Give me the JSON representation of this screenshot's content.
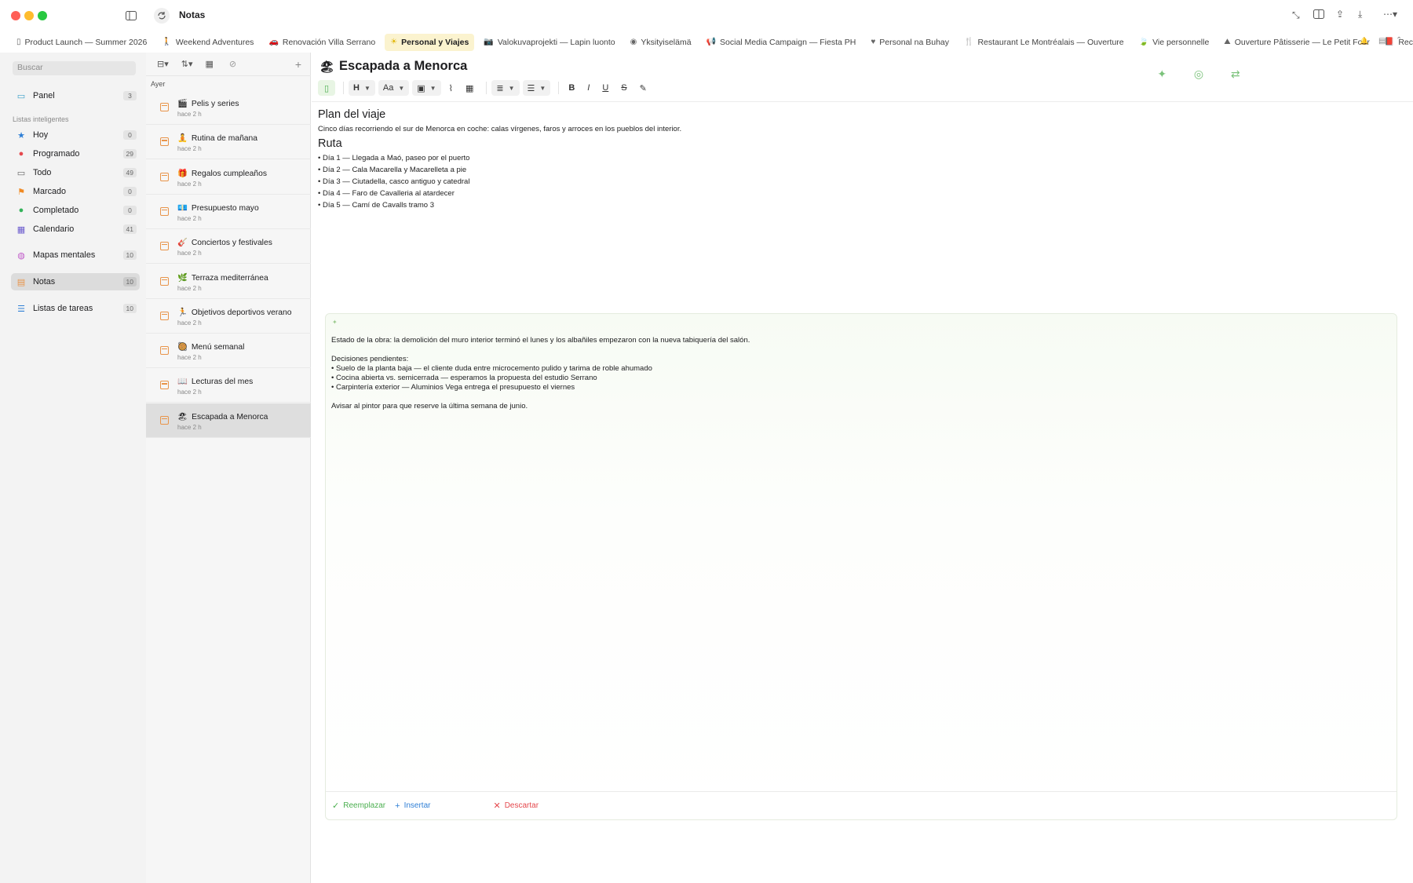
{
  "window": {
    "title": "Notas"
  },
  "tabs": [
    {
      "label": "Product Launch — Summer 2026",
      "icon": "document-icon",
      "glyph": "▯",
      "active": false
    },
    {
      "label": "Weekend Adventures",
      "icon": "hiking-icon",
      "glyph": "🚶",
      "active": false
    },
    {
      "label": "Renovación Villa Serrano",
      "icon": "car-icon",
      "glyph": "🚗",
      "active": false
    },
    {
      "label": "Personal y Viajes",
      "icon": "sun-icon",
      "glyph": "☀",
      "active": true
    },
    {
      "label": "Valokuvaprojekti — Lapin luonto",
      "icon": "camera-icon",
      "glyph": "📷",
      "active": false
    },
    {
      "label": "Yksityiselämä",
      "icon": "circle-icon",
      "glyph": "◉",
      "active": false
    },
    {
      "label": "Social Media Campaign — Fiesta PH",
      "icon": "megaphone-icon",
      "glyph": "📢",
      "active": false
    },
    {
      "label": "Personal na Buhay",
      "icon": "heart-icon",
      "glyph": "♥",
      "active": false
    },
    {
      "label": "Restaurant Le Montréalais — Ouverture",
      "icon": "fork-knife-icon",
      "glyph": "🍴",
      "active": false
    },
    {
      "label": "Vie personnelle",
      "icon": "leaf-icon",
      "glyph": "🍃",
      "active": false
    },
    {
      "label": "Ouverture Pâtisserie — Le Petit Four",
      "icon": "cake-icon",
      "glyph": "⛰",
      "active": false
    },
    {
      "label": "Recettes & Inspirations",
      "icon": "book-icon",
      "glyph": "📕",
      "active": false
    }
  ],
  "sidebar": {
    "search_placeholder": "Buscar",
    "panel": {
      "label": "Panel",
      "count": "3"
    },
    "smart_heading": "Listas inteligentes",
    "smart": [
      {
        "label": "Hoy",
        "count": "0",
        "icon": "star-icon",
        "glyph": "★",
        "color": "#2f7fd6"
      },
      {
        "label": "Programado",
        "count": "29",
        "icon": "clock-icon",
        "glyph": "●",
        "color": "#e5484d"
      },
      {
        "label": "Todo",
        "count": "49",
        "icon": "tray-icon",
        "glyph": "▭",
        "color": "#666666"
      },
      {
        "label": "Marcado",
        "count": "0",
        "icon": "flag-icon",
        "glyph": "⚑",
        "color": "#f08a24"
      },
      {
        "label": "Completado",
        "count": "0",
        "icon": "check-circle-icon",
        "glyph": "●",
        "color": "#34b35a"
      },
      {
        "label": "Calendario",
        "count": "41",
        "icon": "calendar-icon",
        "glyph": "▦",
        "color": "#6a5acd"
      }
    ],
    "mindmaps": {
      "label": "Mapas mentales",
      "count": "10",
      "icon": "brain-icon",
      "glyph": "◍",
      "color": "#c05ac9"
    },
    "notes": {
      "label": "Notas",
      "count": "10",
      "icon": "notes-icon",
      "glyph": "▤",
      "color": "#e8944a"
    },
    "tasks": {
      "label": "Listas de tareas",
      "count": "10",
      "icon": "checklist-icon",
      "glyph": "☰",
      "color": "#2f7fd6"
    }
  },
  "notelist": {
    "group": "Ayer",
    "items": [
      {
        "emoji": "🎬",
        "title": "Pelis y series",
        "time": "hace 2 h"
      },
      {
        "emoji": "🧘",
        "title": "Rutina de mañana",
        "time": "hace 2 h"
      },
      {
        "emoji": "🎁",
        "title": "Regalos cumpleaños",
        "time": "hace 2 h"
      },
      {
        "emoji": "💶",
        "title": "Presupuesto mayo",
        "time": "hace 2 h"
      },
      {
        "emoji": "🎸",
        "title": "Conciertos y festivales",
        "time": "hace 2 h"
      },
      {
        "emoji": "🌿",
        "title": "Terraza mediterránea",
        "time": "hace 2 h"
      },
      {
        "emoji": "🏃",
        "title": "Objetivos deportivos verano",
        "time": "hace 2 h"
      },
      {
        "emoji": "🥘",
        "title": "Menú semanal",
        "time": "hace 2 h"
      },
      {
        "emoji": "📖",
        "title": "Lecturas del mes",
        "time": "hace 2 h"
      },
      {
        "emoji": "🏖",
        "title": "Escapada a Menorca",
        "time": "hace 2 h"
      }
    ]
  },
  "editor": {
    "title_emoji": "🏖",
    "title": "Escapada a Menorca",
    "toolbar": {
      "heading": "H",
      "font": "Aa",
      "bold": "B",
      "italic": "I",
      "underline": "U",
      "strike": "S"
    },
    "heading1": "Plan del viaje",
    "intro": "Cinco días recorriendo el sur de Menorca en coche: calas vírgenes, faros y arroces en los pueblos del interior.",
    "heading2": "Ruta",
    "route": [
      "• Día 1 — Llegada a Maó, paseo por el puerto",
      "• Día 2 — Cala Macarella y Macarelleta a pie",
      "• Día 3 — Ciutadella, casco antiguo y catedral",
      "• Día 4 — Faro de Cavalleria al atardecer",
      "• Día 5 — Camí de Cavalls tramo 3"
    ]
  },
  "ai_panel": {
    "text": "Estado de la obra: la demolición del muro interior terminó el lunes y los albañiles empezaron con la nueva tabiquería del salón.\n\nDecisiones pendientes:\n• Suelo de la planta baja — el cliente duda entre microcemento pulido y tarima de roble ahumado\n• Cocina abierta vs. semicerrada — esperamos la propuesta del estudio Serrano\n• Carpintería exterior — Aluminios Vega entrega el presupuesto el viernes\n\nAvisar al pintor para que reserve la última semana de junio.",
    "replace": "Reemplazar",
    "insert": "Insertar",
    "discard": "Descartar"
  },
  "colors": {
    "accent": "#4caf50",
    "insert": "#2f7fd6",
    "discard": "#e5484d",
    "active_tab": "#fbf3cf"
  }
}
